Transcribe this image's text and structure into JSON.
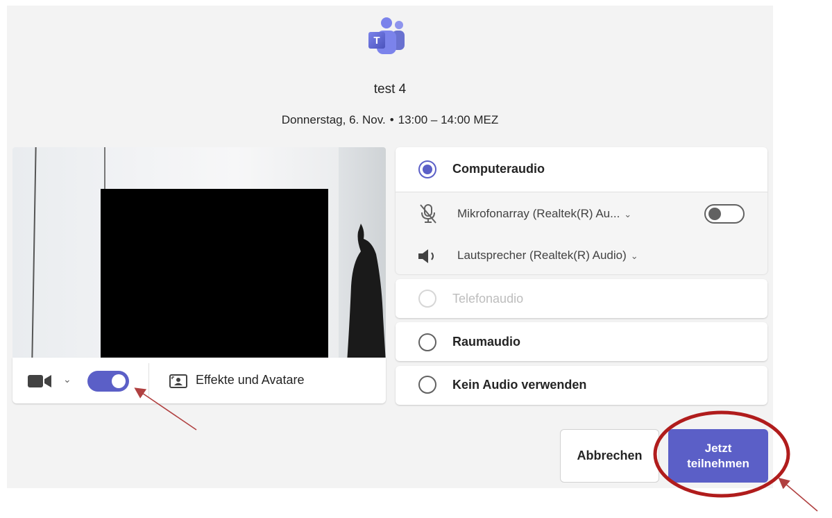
{
  "meeting": {
    "title": "test 4",
    "date": "Donnerstag, 6. Nov.",
    "bullet": "•",
    "time": "13:00 – 14:00 MEZ"
  },
  "video": {
    "camera_on": true,
    "effects_label": "Effekte und Avatare"
  },
  "audio": {
    "computer_label": "Computeraudio",
    "microphone": "Mikrofonarray (Realtek(R) Au...",
    "microphone_on": false,
    "speaker": "Lautsprecher (Realtek(R) Audio)",
    "phone_label": "Telefonaudio",
    "room_label": "Raumaudio",
    "none_label": "Kein Audio verwenden",
    "selected": "Computeraudio"
  },
  "actions": {
    "cancel_label": "Abbrechen",
    "join_label": "Jetzt teilnehmen"
  },
  "colors": {
    "accent": "#5b5fc7",
    "annotation_red": "#b01c1c",
    "panel_bg": "#f3f3f3"
  },
  "icons": [
    "teams-logo-icon",
    "camera-icon",
    "chevron-down-icon",
    "effects-icon",
    "mic-off-icon",
    "speaker-icon"
  ]
}
